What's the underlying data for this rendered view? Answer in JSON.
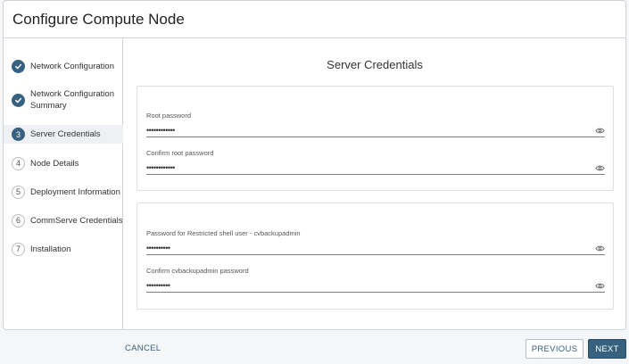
{
  "dialog": {
    "title": "Configure Compute Node"
  },
  "steps": [
    {
      "label": "Network Configuration",
      "marker": "",
      "state": "done"
    },
    {
      "label": "Network Configuration Summary",
      "marker": "",
      "state": "done"
    },
    {
      "label": "Server Credentials",
      "marker": "3",
      "state": "current"
    },
    {
      "label": "Node Details",
      "marker": "4",
      "state": "pending"
    },
    {
      "label": "Deployment Information",
      "marker": "5",
      "state": "pending"
    },
    {
      "label": "CommServe Credentials",
      "marker": "6",
      "state": "pending"
    },
    {
      "label": "Installation",
      "marker": "7",
      "state": "pending"
    }
  ],
  "section": {
    "title": "Server Credentials"
  },
  "root_card": {
    "root_password": {
      "label": "Root password",
      "value": "••••••••••••"
    },
    "confirm_root_password": {
      "label": "Confirm root password",
      "value": "••••••••••••"
    }
  },
  "restricted_card": {
    "restricted_password": {
      "label": "Password for Restricted shell user - cvbackupadmin",
      "value": "••••••••••"
    },
    "confirm_restricted_password": {
      "label": "Confirm cvbackupadmin password",
      "value": "••••••••••"
    }
  },
  "footer": {
    "cancel": "CANCEL",
    "previous": "PREVIOUS",
    "next": "NEXT"
  },
  "icons": {
    "done_step": "check-icon",
    "reveal": "eye-icon"
  },
  "colors": {
    "accent": "#36617f",
    "active_step_bg": "#eef0f3"
  }
}
